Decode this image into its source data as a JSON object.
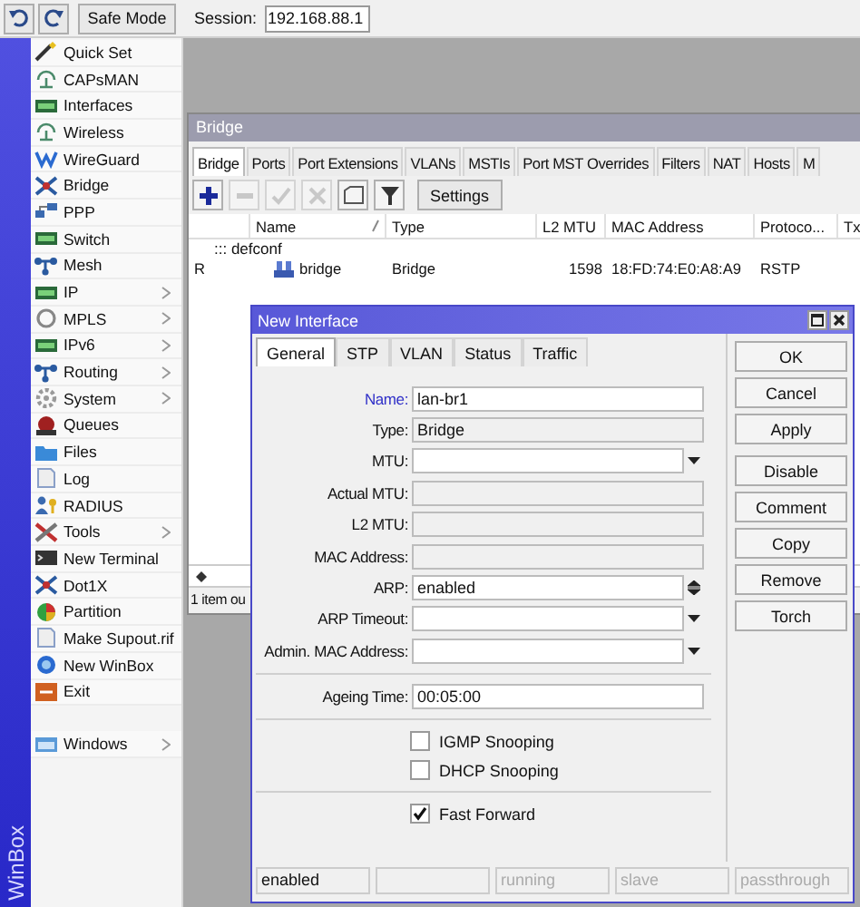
{
  "toolbar": {
    "safe_mode": "Safe Mode",
    "session_label": "Session:",
    "session": "192.168.88.1"
  },
  "sidebar": {
    "brand": "WinBox",
    "items": [
      {
        "label": "Quick Set",
        "has_submenu": false
      },
      {
        "label": "CAPsMAN",
        "has_submenu": false
      },
      {
        "label": "Interfaces",
        "has_submenu": false
      },
      {
        "label": "Wireless",
        "has_submenu": false
      },
      {
        "label": "WireGuard",
        "has_submenu": false
      },
      {
        "label": "Bridge",
        "has_submenu": false
      },
      {
        "label": "PPP",
        "has_submenu": false
      },
      {
        "label": "Switch",
        "has_submenu": false
      },
      {
        "label": "Mesh",
        "has_submenu": false
      },
      {
        "label": "IP",
        "has_submenu": true
      },
      {
        "label": "MPLS",
        "has_submenu": true
      },
      {
        "label": "IPv6",
        "has_submenu": true
      },
      {
        "label": "Routing",
        "has_submenu": true
      },
      {
        "label": "System",
        "has_submenu": true
      },
      {
        "label": "Queues",
        "has_submenu": false
      },
      {
        "label": "Files",
        "has_submenu": false
      },
      {
        "label": "Log",
        "has_submenu": false
      },
      {
        "label": "RADIUS",
        "has_submenu": false
      },
      {
        "label": "Tools",
        "has_submenu": true
      },
      {
        "label": "New Terminal",
        "has_submenu": false
      },
      {
        "label": "Dot1X",
        "has_submenu": false
      },
      {
        "label": "Partition",
        "has_submenu": false
      },
      {
        "label": "Make Supout.rif",
        "has_submenu": false
      },
      {
        "label": "New WinBox",
        "has_submenu": false
      },
      {
        "label": "Exit",
        "has_submenu": false
      }
    ],
    "bottom_items": [
      {
        "label": "Windows",
        "has_submenu": true
      }
    ]
  },
  "bridge_window": {
    "title": "Bridge",
    "tabs": [
      {
        "label": "Bridge",
        "selected": true
      },
      {
        "label": "Ports",
        "selected": false
      },
      {
        "label": "Port Extensions",
        "selected": false
      },
      {
        "label": "VLANs",
        "selected": false
      },
      {
        "label": "MSTIs",
        "selected": false
      },
      {
        "label": "Port MST Overrides",
        "selected": false
      },
      {
        "label": "Filters",
        "selected": false
      },
      {
        "label": "NAT",
        "selected": false
      },
      {
        "label": "Hosts",
        "selected": false
      },
      {
        "label": "M",
        "selected": false
      }
    ],
    "toolbar": [
      {
        "kind": "add",
        "disabled": false
      },
      {
        "kind": "remove",
        "disabled": true
      },
      {
        "kind": "enable",
        "disabled": true
      },
      {
        "kind": "disable",
        "disabled": true
      },
      {
        "kind": "comment",
        "disabled": false
      },
      {
        "kind": "filter",
        "disabled": false
      }
    ],
    "settings_button": "Settings",
    "table": {
      "columns": [
        {
          "sorted": false
        },
        {
          "label": "Name",
          "sorted": true
        },
        {
          "label": "Type",
          "sorted": false
        },
        {
          "label": "L2 MTU",
          "sorted": false
        },
        {
          "label": "MAC Address",
          "sorted": false
        },
        {
          "label": "Protoco...",
          "sorted": false
        },
        {
          "label": "Tx",
          "sorted": false
        }
      ],
      "rows": [
        {
          "kind": "group",
          "label": "::: defconf"
        },
        {
          "kind": "item",
          "cells": [
            "R",
            "bridge",
            "Bridge",
            "1598",
            "18:FD:74:E0:A8:A9",
            "RSTP"
          ]
        }
      ]
    },
    "status": "1 item ou"
  },
  "dialog": {
    "title": "New Interface",
    "tabs": [
      {
        "label": "General",
        "selected": true
      },
      {
        "label": "STP",
        "selected": false
      },
      {
        "label": "VLAN",
        "selected": false
      },
      {
        "label": "Status",
        "selected": false
      },
      {
        "label": "Traffic",
        "selected": false
      }
    ],
    "sections": [
      {
        "fields": [
          {
            "label": "Name:",
            "value": "lan-br1",
            "kind": "text",
            "readonly": false,
            "focused": true
          },
          {
            "label": "Type:",
            "value": "Bridge",
            "kind": "text",
            "readonly": true,
            "focused": false
          },
          {
            "label": "MTU:",
            "kind": "dropdown",
            "readonly": false,
            "focused": false
          },
          {
            "label": "Actual MTU:",
            "kind": "text",
            "readonly": true,
            "focused": false
          },
          {
            "label": "L2 MTU:",
            "kind": "text",
            "readonly": true,
            "focused": false
          },
          {
            "label": "MAC Address:",
            "kind": "text",
            "readonly": true,
            "focused": false
          },
          {
            "label": "ARP:",
            "value": "enabled",
            "kind": "spin",
            "readonly": false,
            "focused": false
          },
          {
            "label": "ARP Timeout:",
            "kind": "dropdown",
            "readonly": false,
            "focused": false
          },
          {
            "label": "Admin. MAC Address:",
            "kind": "dropdown",
            "readonly": false,
            "focused": false
          }
        ]
      },
      {
        "fields": [
          {
            "label": "Ageing Time:",
            "value": "00:05:00",
            "kind": "text",
            "readonly": false,
            "focused": false
          }
        ]
      },
      {
        "checkboxes": [
          {
            "label": "IGMP Snooping",
            "checked": false
          },
          {
            "label": "DHCP Snooping",
            "checked": false
          }
        ]
      },
      {
        "checkboxes": [
          {
            "label": "Fast Forward",
            "checked": true
          }
        ]
      }
    ],
    "button_groups": [
      [
        "OK",
        "Cancel",
        "Apply"
      ],
      [
        "Disable",
        "Comment",
        "Copy",
        "Remove",
        "Torch"
      ]
    ],
    "status": [
      {
        "kind": "text",
        "text": "enabled",
        "dimmed": false
      },
      {
        "kind": "empty"
      },
      {
        "kind": "text",
        "text": "running",
        "dimmed": true
      },
      {
        "kind": "text",
        "text": "slave",
        "dimmed": true
      },
      {
        "kind": "text",
        "text": "passthrough",
        "dimmed": true
      }
    ]
  }
}
